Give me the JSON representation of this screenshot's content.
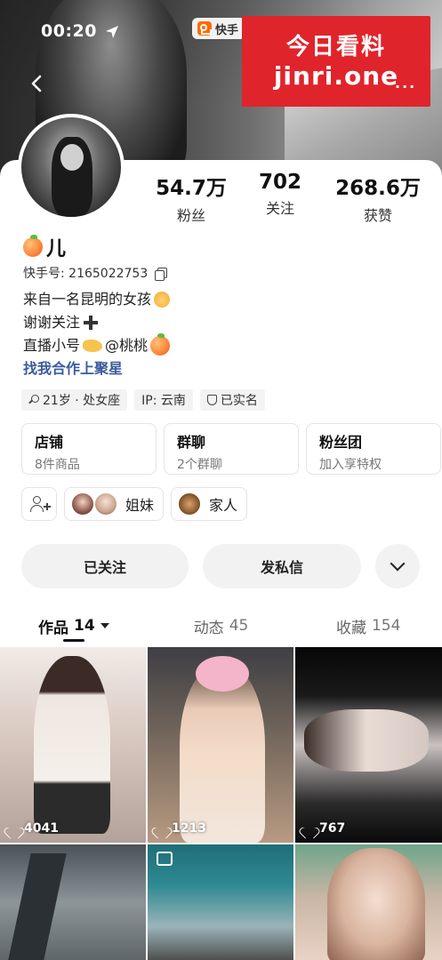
{
  "status_bar": {
    "time": "00:20"
  },
  "header": {
    "app_badge": "快手"
  },
  "watermark": {
    "line1": "今日看料",
    "line2": "jinri.one"
  },
  "more_menu": {
    "label": "..."
  },
  "stats": [
    {
      "value": "54.7万",
      "label": "粉丝"
    },
    {
      "value": "702",
      "label": "关注"
    },
    {
      "value": "268.6万",
      "label": "获赞"
    }
  ],
  "profile": {
    "name": "儿",
    "id_label": "快手号: 2165022753",
    "bio": {
      "line1": "来自一名昆明的女孩",
      "line2": "谢谢关注",
      "line3": "直播小号",
      "line3_mention": "@桃桃",
      "link": "找我合作上聚星"
    }
  },
  "tags": {
    "age": "21岁 · 处女座",
    "ip": "IP: 云南",
    "verified": "已实名"
  },
  "entries": [
    {
      "title": "店铺",
      "sub": "8件商品"
    },
    {
      "title": "群聊",
      "sub": "2个群聊"
    },
    {
      "title": "粉丝团",
      "sub": "加入享特权"
    }
  ],
  "social": {
    "chip1": "姐妹",
    "chip2": "家人"
  },
  "actions": {
    "follow": "已关注",
    "message": "发私信"
  },
  "tabs": [
    {
      "label": "作品",
      "count": "14"
    },
    {
      "label": "动态",
      "count": "45"
    },
    {
      "label": "收藏",
      "count": "154"
    }
  ],
  "grid": [
    {
      "likes": "4041"
    },
    {
      "likes": "1213"
    },
    {
      "likes": "767"
    }
  ],
  "colors": {
    "watermark_red": "#e0242b",
    "link_blue": "#3a5b9f",
    "brand_orange": "#ff6a00"
  }
}
